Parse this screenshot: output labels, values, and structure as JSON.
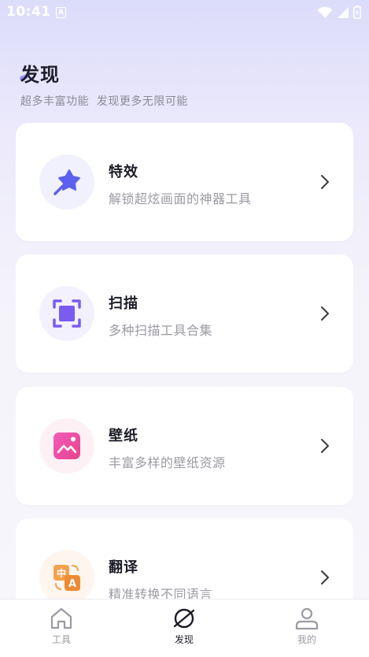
{
  "status_bar": {
    "time": "10:41",
    "notification_glyph": "A"
  },
  "header": {
    "title": "发现",
    "subtitle": "超多丰富功能  发现更多无限可能"
  },
  "features": [
    {
      "title": "特效",
      "description": "解锁超炫画面的神器工具",
      "icon": "magic-wand-star-icon",
      "color": "#5c5ff0"
    },
    {
      "title": "扫描",
      "description": "多种扫描工具合集",
      "icon": "scan-frame-icon",
      "color": "#7a5cf0"
    },
    {
      "title": "壁纸",
      "description": "丰富多样的壁纸资源",
      "icon": "wallpaper-image-icon",
      "color": "#ee4aa8"
    },
    {
      "title": "翻译",
      "description": "精准转换不同语言",
      "icon": "translate-icon",
      "color": "#f4a14e"
    }
  ],
  "tab_bar": {
    "items": [
      {
        "label": "工具",
        "icon": "home-icon",
        "active": false
      },
      {
        "label": "发现",
        "icon": "planet-icon",
        "active": true
      },
      {
        "label": "我的",
        "icon": "user-icon",
        "active": false
      }
    ]
  }
}
